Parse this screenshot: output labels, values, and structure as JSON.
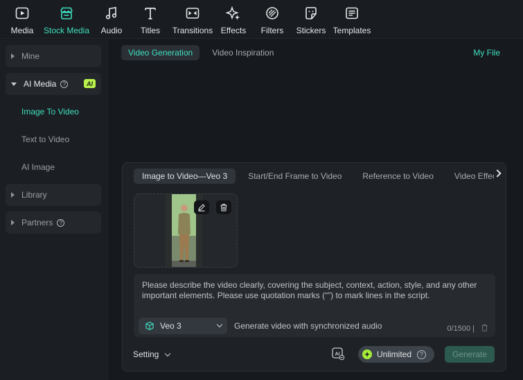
{
  "toolbar": {
    "items": [
      {
        "label": "Media",
        "icon": "media-icon"
      },
      {
        "label": "Stock Media",
        "icon": "store-icon",
        "active": true
      },
      {
        "label": "Audio",
        "icon": "music-note-icon"
      },
      {
        "label": "Titles",
        "icon": "text-t-icon"
      },
      {
        "label": "Transitions",
        "icon": "transition-icon"
      },
      {
        "label": "Effects",
        "icon": "sparkle-icon"
      },
      {
        "label": "Filters",
        "icon": "filter-icon"
      },
      {
        "label": "Stickers",
        "icon": "sticker-icon"
      },
      {
        "label": "Templates",
        "icon": "template-icon"
      }
    ]
  },
  "sidebar": {
    "mine": "Mine",
    "ai_media": "AI Media",
    "ai_badge": "AI",
    "sub_items": [
      "Image To Video",
      "Text to Video",
      "AI Image"
    ],
    "library": "Library",
    "partners": "Partners"
  },
  "main": {
    "tabs": [
      "Video Generation",
      "Video Inspiration"
    ],
    "my_file": "My File"
  },
  "panel": {
    "subtabs": [
      "Image to Video—Veo 3",
      "Start/End Frame to Video",
      "Reference to Video",
      "Video Effects"
    ],
    "prompt_placeholder": "Please describe the video clearly, covering the subject, context, action, style, and any other important elements. Please use quotation marks (“”) to mark lines in the script.",
    "model": "Veo 3",
    "audio_note": "Generate video with synchronized audio",
    "counter": "0/1500 |",
    "setting": "Setting",
    "unlimited": "Unlimited",
    "generate": "Generate"
  },
  "colors": {
    "accent": "#3fe0c0",
    "ai_badge": "#b9f24a",
    "generate_bg": "#2d5a4e"
  }
}
